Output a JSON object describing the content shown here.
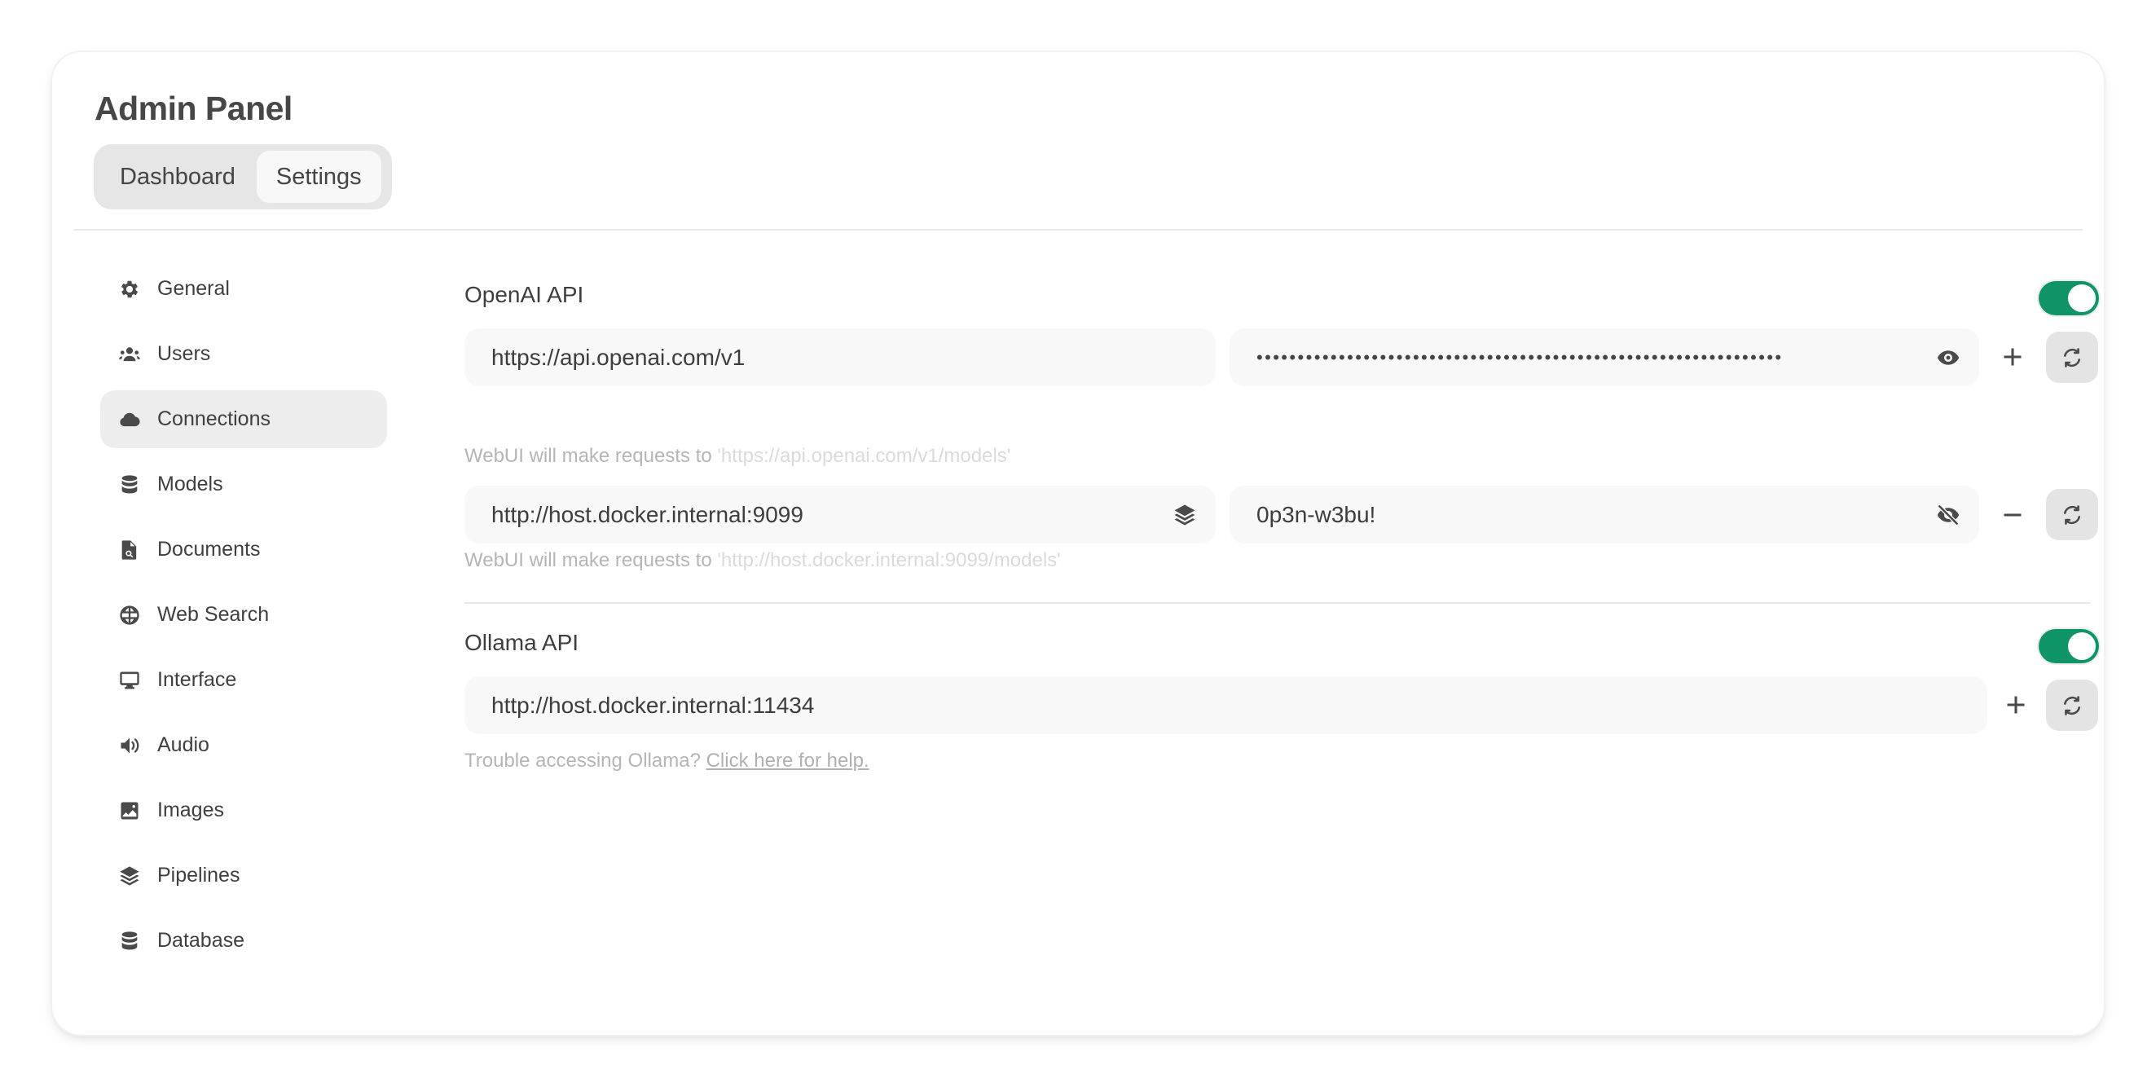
{
  "header": {
    "title": "Admin Panel",
    "tabs": [
      {
        "label": "Dashboard",
        "active": false
      },
      {
        "label": "Settings",
        "active": true
      }
    ]
  },
  "sidebar": {
    "items": [
      {
        "label": "General",
        "icon": "gear-icon",
        "active": false
      },
      {
        "label": "Users",
        "icon": "users-icon",
        "active": false
      },
      {
        "label": "Connections",
        "icon": "cloud-icon",
        "active": true
      },
      {
        "label": "Models",
        "icon": "database-icon",
        "active": false
      },
      {
        "label": "Documents",
        "icon": "document-search-icon",
        "active": false
      },
      {
        "label": "Web Search",
        "icon": "globe-icon",
        "active": false
      },
      {
        "label": "Interface",
        "icon": "monitor-icon",
        "active": false
      },
      {
        "label": "Audio",
        "icon": "speaker-icon",
        "active": false
      },
      {
        "label": "Images",
        "icon": "image-icon",
        "active": false
      },
      {
        "label": "Pipelines",
        "icon": "layers-icon",
        "active": false
      },
      {
        "label": "Database",
        "icon": "database-icon",
        "active": false
      }
    ]
  },
  "openai": {
    "label": "OpenAI API",
    "enabled": true,
    "connections": [
      {
        "url": "https://api.openai.com/v1",
        "key_masked": "••••••••••••••••••••••••••••••••••••••••••••••••••••••••••••••••",
        "key_visible": false,
        "helper_prefix": "WebUI will make requests to",
        "helper_url": "'https://api.openai.com/v1/models'",
        "action": "add"
      },
      {
        "url": "http://host.docker.internal:9099",
        "key": "0p3n-w3bu!",
        "key_visible": true,
        "helper_prefix": "WebUI will make requests to",
        "helper_url": "'http://host.docker.internal:9099/models'",
        "action": "remove"
      }
    ]
  },
  "ollama": {
    "label": "Ollama API",
    "enabled": true,
    "url": "http://host.docker.internal:11434",
    "help_prefix": "Trouble accessing Ollama?",
    "help_link": "Click here for help."
  },
  "colors": {
    "toggle_on": "#0f9467",
    "active_bg": "#ededed",
    "input_bg": "#f8f8f8"
  }
}
